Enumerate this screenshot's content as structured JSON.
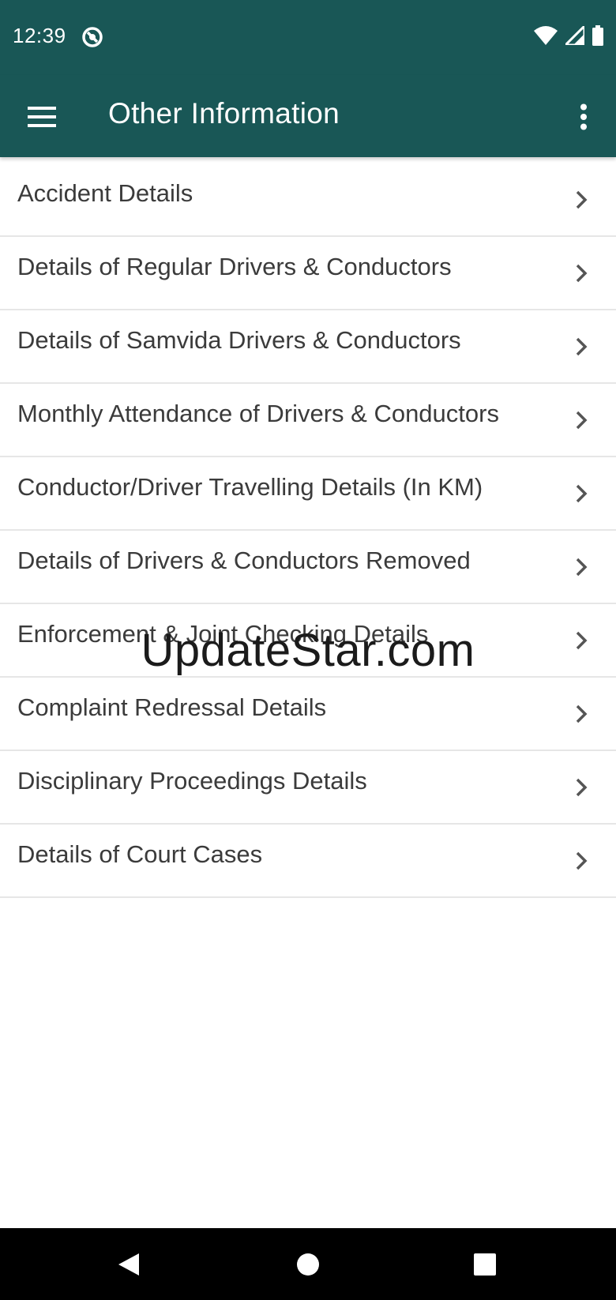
{
  "status_bar": {
    "time": "12:39",
    "icons": [
      "sync-icon",
      "wifi-icon",
      "signal-icon",
      "battery-icon"
    ]
  },
  "app_bar": {
    "title": "Other Information",
    "left_icon": "hamburger-menu-icon",
    "right_icon": "more-vert-icon",
    "background": "#195756"
  },
  "list": {
    "items": [
      {
        "label": "Accident Details"
      },
      {
        "label": "Details of Regular Drivers & Conductors"
      },
      {
        "label": "Details of Samvida Drivers & Conductors"
      },
      {
        "label": "Monthly Attendance of Drivers & Conductors"
      },
      {
        "label": "Conductor/Driver Travelling Details (In KM)"
      },
      {
        "label": "Details of Drivers & Conductors Removed"
      },
      {
        "label": "Enforcement & Joint Checking Details"
      },
      {
        "label": "Complaint Redressal Details"
      },
      {
        "label": "Disciplinary Proceedings Details"
      },
      {
        "label": "Details of Court Cases"
      }
    ]
  },
  "watermark": "UpdateStar.com",
  "nav_bar": {
    "icons": [
      "back-icon",
      "home-icon",
      "recents-icon"
    ]
  }
}
